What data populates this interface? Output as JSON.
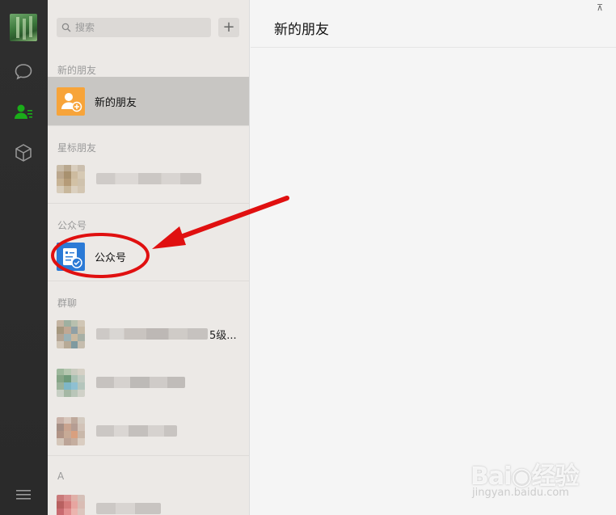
{
  "search": {
    "placeholder": "搜索"
  },
  "add_button": "+",
  "sections": {
    "new_friends": "新的朋友",
    "starred": "星标朋友",
    "official": "公众号",
    "groups": "群聊",
    "letter_a": "A"
  },
  "rows": {
    "new_friends": "新的朋友",
    "official": "公众号",
    "group1_suffix": "5级..."
  },
  "main": {
    "title": "新的朋友",
    "pin": "⊼"
  },
  "watermark": {
    "brand": "Bai◉经验",
    "url": "jingyan.baidu.com"
  },
  "colors": {
    "accent_green": "#1aad19",
    "new_friend_orange": "#f7a43a",
    "official_blue": "#2b7ad6",
    "annotation_red": "#e01010"
  },
  "icons": [
    "chat-icon",
    "contacts-icon",
    "box-icon",
    "menu-icon",
    "search-icon",
    "add-friend-icon",
    "official-account-icon"
  ]
}
